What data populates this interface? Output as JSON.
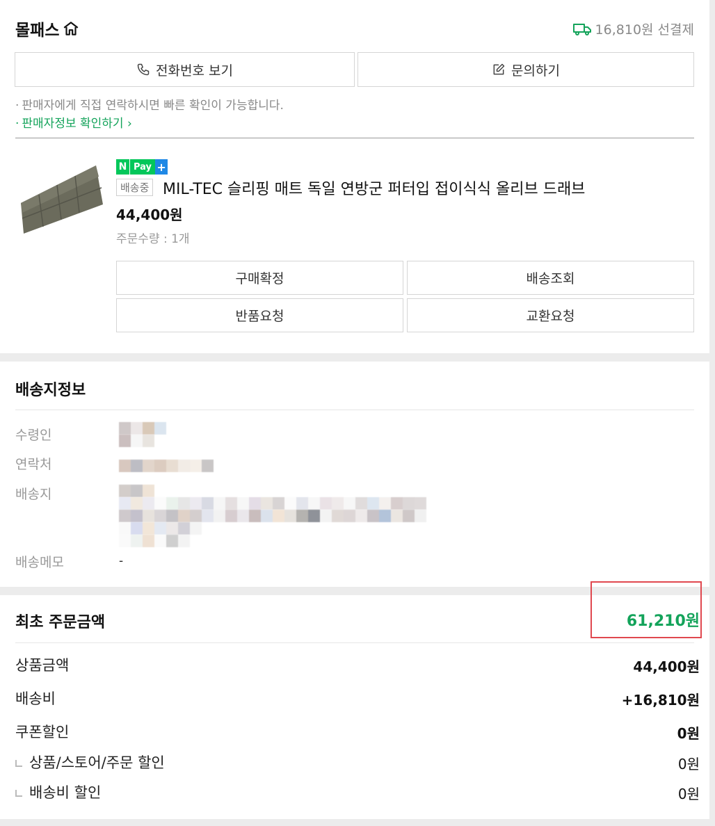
{
  "seller": {
    "store_name": "몰패스",
    "shipping_fee": "16,810원 선결제",
    "phone_button": "전화번호 보기",
    "inquiry_button": "문의하기",
    "notice": "판매자에게 직접 연락하시면 빠른 확인이 가능합니다.",
    "seller_info_link": "판매자정보 확인하기"
  },
  "product": {
    "npay_n": "N",
    "npay_pay": "Pay",
    "npay_plus": "+",
    "status": "배송중",
    "title": "MIL-TEC 슬리핑 매트 독일 연방군 퍼터입 접이식식 올리브 드래브",
    "price": "44,400원",
    "quantity": "주문수량 : 1개",
    "actions": {
      "confirm": "구매확정",
      "track": "배송조회",
      "return": "반품요청",
      "exchange": "교환요청"
    }
  },
  "shipping_info": {
    "title": "배송지정보",
    "recipient_label": "수령인",
    "contact_label": "연락처",
    "address_label": "배송지",
    "memo_label": "배송메모",
    "memo_value": "-"
  },
  "price_info": {
    "title": "최초 주문금액",
    "total": "61,210원",
    "product_amount_label": "상품금액",
    "product_amount": "44,400원",
    "shipping_label": "배송비",
    "shipping_amount": "+16,810원",
    "coupon_label": "쿠폰할인",
    "coupon_amount": "0원",
    "store_discount_label": "상품/스토어/주문 할인",
    "store_discount_amount": "0원",
    "shipping_discount_label": "배송비 할인",
    "shipping_discount_amount": "0원"
  },
  "colors": {
    "accent_green": "#13a35a",
    "highlight_red": "#e0484f",
    "npay_green": "#03c75a",
    "npay_blue": "#1e88e5"
  },
  "icons": [
    "home-icon",
    "truck-icon",
    "phone-icon",
    "edit-icon",
    "chevron-right-icon"
  ]
}
